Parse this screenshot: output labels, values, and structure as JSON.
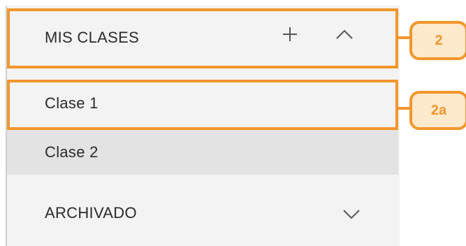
{
  "sidebar": {
    "header_label": "MIS CLASES",
    "classes": [
      {
        "label": "Clase 1"
      },
      {
        "label": "Clase 2"
      }
    ],
    "archived_label": "ARCHIVADO"
  },
  "annotations": {
    "callout_header": "2",
    "callout_class": "2a"
  },
  "colors": {
    "accent": "#f2962c",
    "callout_fill": "#fde9cc",
    "panel_bg": "#f3f3f3",
    "selected_bg": "#e3e3e3"
  },
  "icons": [
    "plus-icon",
    "chevron-up-icon",
    "chevron-down-icon"
  ]
}
